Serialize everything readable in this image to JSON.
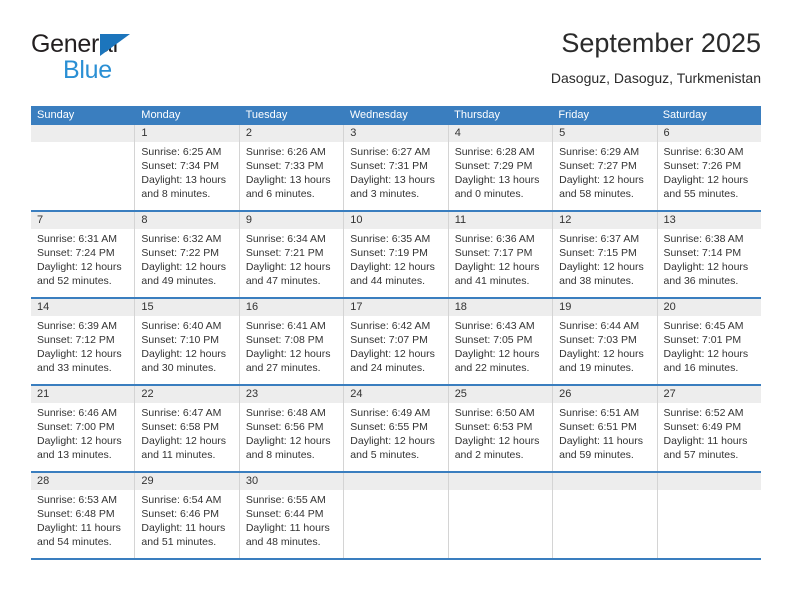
{
  "brand": {
    "name_top": "General",
    "name_bottom": "Blue",
    "accent_color": "#2a8fd4",
    "triangle_color": "#1c75bc"
  },
  "header": {
    "title": "September 2025",
    "subtitle": "Dasoguz, Dasoguz, Turkmenistan"
  },
  "theme": {
    "header_row_color": "#3a7ebf",
    "daynum_band_color": "#ededed",
    "row_border_color": "#3a7ebf"
  },
  "weekday_headers": [
    "Sunday",
    "Monday",
    "Tuesday",
    "Wednesday",
    "Thursday",
    "Friday",
    "Saturday"
  ],
  "weeks": [
    [
      {
        "day": "",
        "empty": true,
        "sunrise": "",
        "sunset": "",
        "daylight1": "",
        "daylight2": ""
      },
      {
        "day": "1",
        "sunrise": "Sunrise: 6:25 AM",
        "sunset": "Sunset: 7:34 PM",
        "daylight1": "Daylight: 13 hours",
        "daylight2": "and 8 minutes."
      },
      {
        "day": "2",
        "sunrise": "Sunrise: 6:26 AM",
        "sunset": "Sunset: 7:33 PM",
        "daylight1": "Daylight: 13 hours",
        "daylight2": "and 6 minutes."
      },
      {
        "day": "3",
        "sunrise": "Sunrise: 6:27 AM",
        "sunset": "Sunset: 7:31 PM",
        "daylight1": "Daylight: 13 hours",
        "daylight2": "and 3 minutes."
      },
      {
        "day": "4",
        "sunrise": "Sunrise: 6:28 AM",
        "sunset": "Sunset: 7:29 PM",
        "daylight1": "Daylight: 13 hours",
        "daylight2": "and 0 minutes."
      },
      {
        "day": "5",
        "sunrise": "Sunrise: 6:29 AM",
        "sunset": "Sunset: 7:27 PM",
        "daylight1": "Daylight: 12 hours",
        "daylight2": "and 58 minutes."
      },
      {
        "day": "6",
        "sunrise": "Sunrise: 6:30 AM",
        "sunset": "Sunset: 7:26 PM",
        "daylight1": "Daylight: 12 hours",
        "daylight2": "and 55 minutes."
      }
    ],
    [
      {
        "day": "7",
        "sunrise": "Sunrise: 6:31 AM",
        "sunset": "Sunset: 7:24 PM",
        "daylight1": "Daylight: 12 hours",
        "daylight2": "and 52 minutes."
      },
      {
        "day": "8",
        "sunrise": "Sunrise: 6:32 AM",
        "sunset": "Sunset: 7:22 PM",
        "daylight1": "Daylight: 12 hours",
        "daylight2": "and 49 minutes."
      },
      {
        "day": "9",
        "sunrise": "Sunrise: 6:34 AM",
        "sunset": "Sunset: 7:21 PM",
        "daylight1": "Daylight: 12 hours",
        "daylight2": "and 47 minutes."
      },
      {
        "day": "10",
        "sunrise": "Sunrise: 6:35 AM",
        "sunset": "Sunset: 7:19 PM",
        "daylight1": "Daylight: 12 hours",
        "daylight2": "and 44 minutes."
      },
      {
        "day": "11",
        "sunrise": "Sunrise: 6:36 AM",
        "sunset": "Sunset: 7:17 PM",
        "daylight1": "Daylight: 12 hours",
        "daylight2": "and 41 minutes."
      },
      {
        "day": "12",
        "sunrise": "Sunrise: 6:37 AM",
        "sunset": "Sunset: 7:15 PM",
        "daylight1": "Daylight: 12 hours",
        "daylight2": "and 38 minutes."
      },
      {
        "day": "13",
        "sunrise": "Sunrise: 6:38 AM",
        "sunset": "Sunset: 7:14 PM",
        "daylight1": "Daylight: 12 hours",
        "daylight2": "and 36 minutes."
      }
    ],
    [
      {
        "day": "14",
        "sunrise": "Sunrise: 6:39 AM",
        "sunset": "Sunset: 7:12 PM",
        "daylight1": "Daylight: 12 hours",
        "daylight2": "and 33 minutes."
      },
      {
        "day": "15",
        "sunrise": "Sunrise: 6:40 AM",
        "sunset": "Sunset: 7:10 PM",
        "daylight1": "Daylight: 12 hours",
        "daylight2": "and 30 minutes."
      },
      {
        "day": "16",
        "sunrise": "Sunrise: 6:41 AM",
        "sunset": "Sunset: 7:08 PM",
        "daylight1": "Daylight: 12 hours",
        "daylight2": "and 27 minutes."
      },
      {
        "day": "17",
        "sunrise": "Sunrise: 6:42 AM",
        "sunset": "Sunset: 7:07 PM",
        "daylight1": "Daylight: 12 hours",
        "daylight2": "and 24 minutes."
      },
      {
        "day": "18",
        "sunrise": "Sunrise: 6:43 AM",
        "sunset": "Sunset: 7:05 PM",
        "daylight1": "Daylight: 12 hours",
        "daylight2": "and 22 minutes."
      },
      {
        "day": "19",
        "sunrise": "Sunrise: 6:44 AM",
        "sunset": "Sunset: 7:03 PM",
        "daylight1": "Daylight: 12 hours",
        "daylight2": "and 19 minutes."
      },
      {
        "day": "20",
        "sunrise": "Sunrise: 6:45 AM",
        "sunset": "Sunset: 7:01 PM",
        "daylight1": "Daylight: 12 hours",
        "daylight2": "and 16 minutes."
      }
    ],
    [
      {
        "day": "21",
        "sunrise": "Sunrise: 6:46 AM",
        "sunset": "Sunset: 7:00 PM",
        "daylight1": "Daylight: 12 hours",
        "daylight2": "and 13 minutes."
      },
      {
        "day": "22",
        "sunrise": "Sunrise: 6:47 AM",
        "sunset": "Sunset: 6:58 PM",
        "daylight1": "Daylight: 12 hours",
        "daylight2": "and 11 minutes."
      },
      {
        "day": "23",
        "sunrise": "Sunrise: 6:48 AM",
        "sunset": "Sunset: 6:56 PM",
        "daylight1": "Daylight: 12 hours",
        "daylight2": "and 8 minutes."
      },
      {
        "day": "24",
        "sunrise": "Sunrise: 6:49 AM",
        "sunset": "Sunset: 6:55 PM",
        "daylight1": "Daylight: 12 hours",
        "daylight2": "and 5 minutes."
      },
      {
        "day": "25",
        "sunrise": "Sunrise: 6:50 AM",
        "sunset": "Sunset: 6:53 PM",
        "daylight1": "Daylight: 12 hours",
        "daylight2": "and 2 minutes."
      },
      {
        "day": "26",
        "sunrise": "Sunrise: 6:51 AM",
        "sunset": "Sunset: 6:51 PM",
        "daylight1": "Daylight: 11 hours",
        "daylight2": "and 59 minutes."
      },
      {
        "day": "27",
        "sunrise": "Sunrise: 6:52 AM",
        "sunset": "Sunset: 6:49 PM",
        "daylight1": "Daylight: 11 hours",
        "daylight2": "and 57 minutes."
      }
    ],
    [
      {
        "day": "28",
        "sunrise": "Sunrise: 6:53 AM",
        "sunset": "Sunset: 6:48 PM",
        "daylight1": "Daylight: 11 hours",
        "daylight2": "and 54 minutes."
      },
      {
        "day": "29",
        "sunrise": "Sunrise: 6:54 AM",
        "sunset": "Sunset: 6:46 PM",
        "daylight1": "Daylight: 11 hours",
        "daylight2": "and 51 minutes."
      },
      {
        "day": "30",
        "sunrise": "Sunrise: 6:55 AM",
        "sunset": "Sunset: 6:44 PM",
        "daylight1": "Daylight: 11 hours",
        "daylight2": "and 48 minutes."
      },
      {
        "day": "",
        "empty": true,
        "sunrise": "",
        "sunset": "",
        "daylight1": "",
        "daylight2": ""
      },
      {
        "day": "",
        "empty": true,
        "sunrise": "",
        "sunset": "",
        "daylight1": "",
        "daylight2": ""
      },
      {
        "day": "",
        "empty": true,
        "sunrise": "",
        "sunset": "",
        "daylight1": "",
        "daylight2": ""
      },
      {
        "day": "",
        "empty": true,
        "sunrise": "",
        "sunset": "",
        "daylight1": "",
        "daylight2": ""
      }
    ]
  ]
}
